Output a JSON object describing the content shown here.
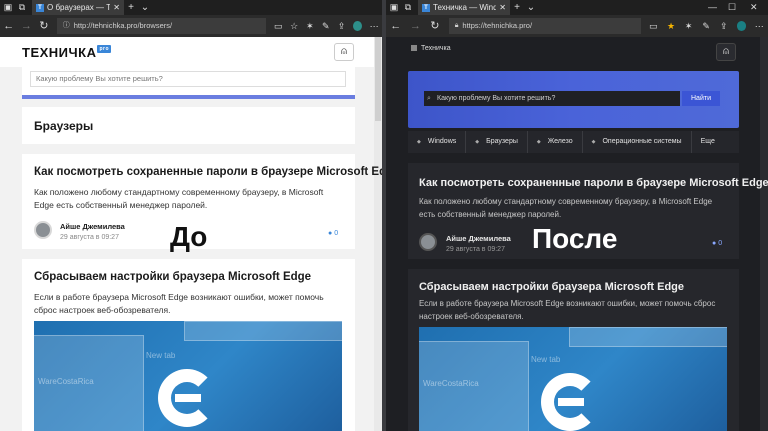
{
  "left": {
    "tab_title": "О браузерах — Технич",
    "url": "http://tehnichka.pro/browsers/",
    "logo": "ТЕХНИЧКА",
    "logo_badge": "pro",
    "search_placeholder": "Какую проблему Вы хотите решить?",
    "category_title": "Браузеры",
    "label": "До",
    "articles": [
      {
        "title": "Как посмотреть сохраненные пароли в браузере Microsoft Edge",
        "excerpt": "Как положено любому стандартному современному браузеру, в Microsoft Edge есть собственный менеджер паролей.",
        "author": "Айше Джемилева",
        "date": "29 августа в 09:27",
        "comments": "0"
      },
      {
        "title": "Сбрасываем настройки браузера Microsoft Edge",
        "excerpt": "Если в работе браузера Microsoft Edge возникают ошибки, может помочь сброс настроек веб-обозревателя."
      }
    ]
  },
  "right": {
    "tab_title": "Техничка — Windows, (",
    "url": "https://tehnichka.pro/",
    "logo": "Техничка",
    "search_placeholder": "Какую проблему Вы хотите решить?",
    "search_button": "Найти",
    "nav": [
      "Windows",
      "Браузеры",
      "Железо",
      "Операционные системы",
      "Еще"
    ],
    "label": "После",
    "articles": [
      {
        "title": "Как посмотреть сохраненные пароли в браузере Microsoft Edge",
        "excerpt": "Как положено любому стандартному современному браузеру, в Microsoft Edge есть собственный менеджер паролей.",
        "author": "Айше Джемилева",
        "date": "29 августа в 09:27",
        "comments": "0"
      },
      {
        "title": "Сбрасываем настройки браузера Microsoft Edge",
        "excerpt": "Если в работе браузера Microsoft Edge возникают ошибки, может помочь сброс настроек веб-обозревателя."
      }
    ]
  },
  "image_watermark": "WareCostaRica",
  "image_tab_text": "New tab",
  "colors": {
    "accent": "#3a86d8",
    "hero": "#4a63d9",
    "favorite_star": "#f5b400"
  }
}
